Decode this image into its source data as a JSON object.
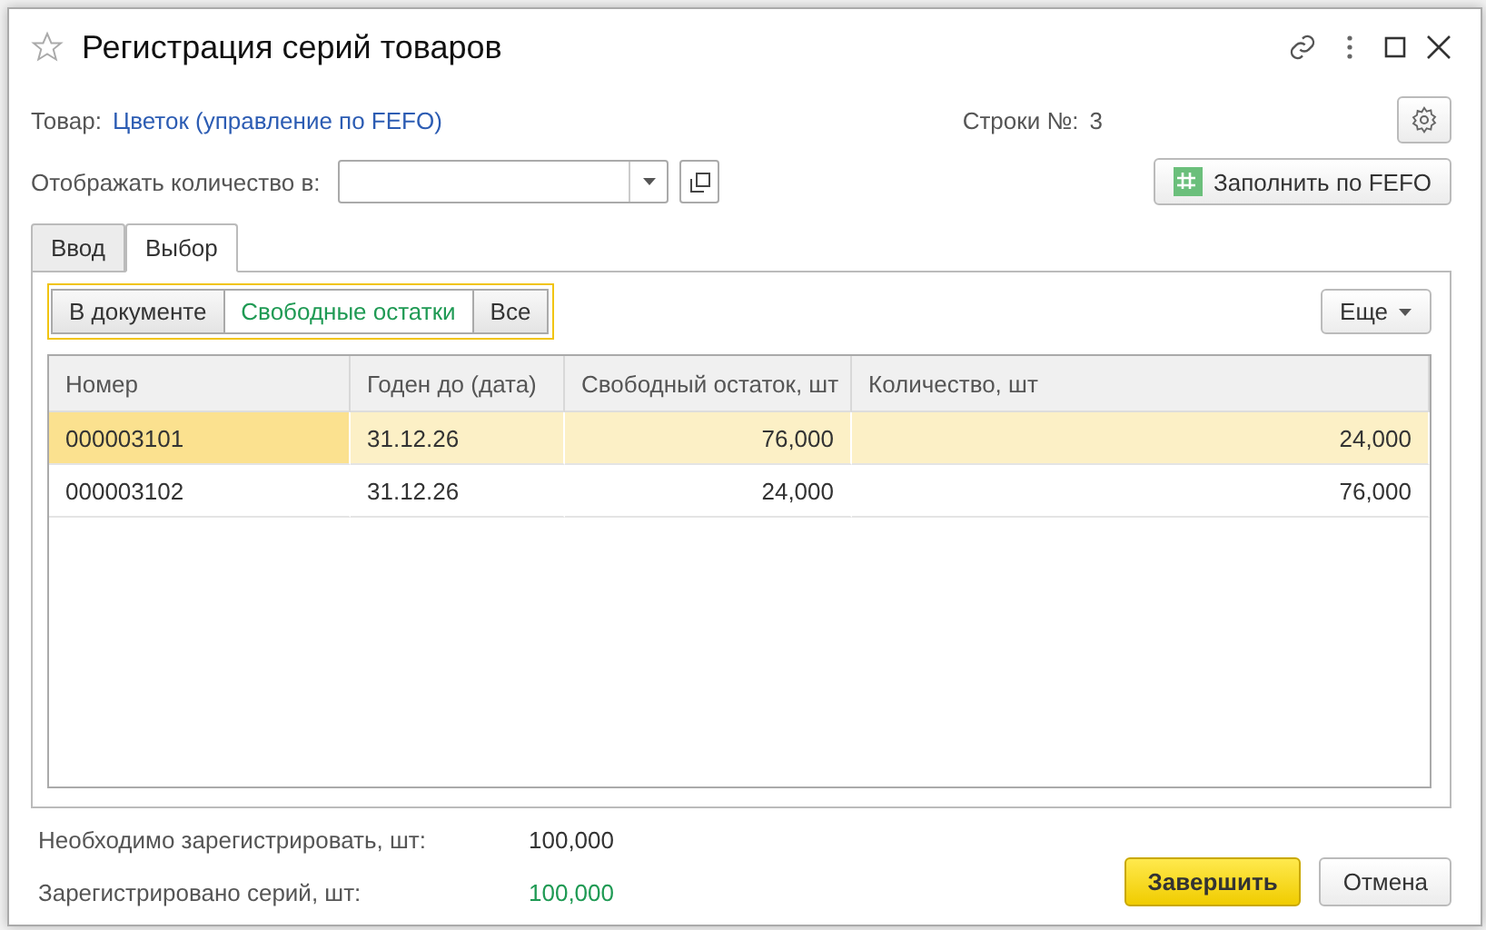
{
  "window": {
    "title": "Регистрация серий товаров"
  },
  "product": {
    "label": "Товар:",
    "value": "Цветок (управление по FEFO)"
  },
  "rows_count": {
    "label": "Строки №:",
    "value": "3"
  },
  "display_unit": {
    "label": "Отображать количество в:"
  },
  "fill_button": {
    "label": "Заполнить по FEFO"
  },
  "tabs": [
    {
      "label": "Ввод",
      "selected": false
    },
    {
      "label": "Выбор",
      "selected": true
    }
  ],
  "filters": [
    {
      "label": "В документе",
      "selected": false
    },
    {
      "label": "Свободные остатки",
      "selected": true
    },
    {
      "label": "Все",
      "selected": false
    }
  ],
  "more_button": {
    "label": "Еще"
  },
  "table": {
    "columns": [
      "Номер",
      "Годен до (дата)",
      "Свободный остаток, шт",
      "Количество, шт"
    ],
    "rows": [
      {
        "cells": [
          "000003101",
          "31.12.26",
          "76,000",
          "24,000"
        ],
        "selected": true
      },
      {
        "cells": [
          "000003102",
          "31.12.26",
          "24,000",
          "76,000"
        ],
        "selected": false
      }
    ]
  },
  "totals": [
    {
      "label": "Необходимо зарегистрировать, шт:",
      "value": "100,000",
      "color": "#333333"
    },
    {
      "label": "Зарегистрировано серий, шт:",
      "value": "100,000",
      "color": "#1f9a54"
    }
  ],
  "buttons": [
    {
      "label": "Завершить",
      "kind": "primary"
    },
    {
      "label": "Отмена",
      "kind": "secondary"
    }
  ]
}
